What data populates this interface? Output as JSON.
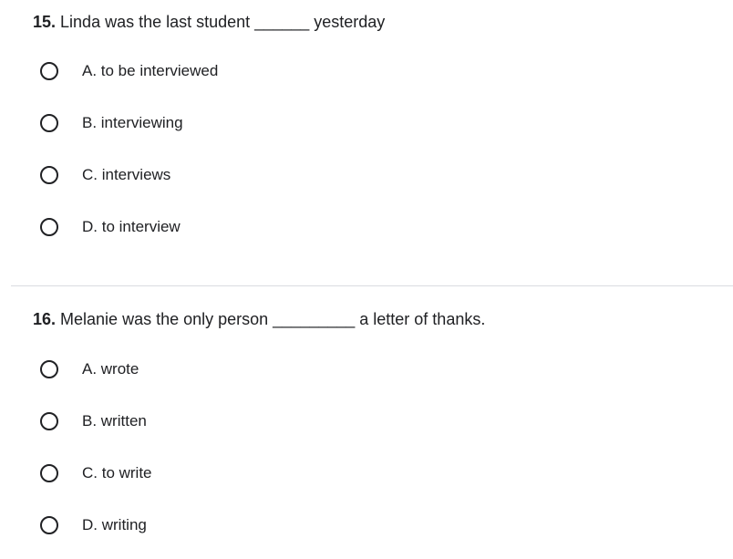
{
  "questions": [
    {
      "number": "15.",
      "text": " Linda was the last student ______ yesterday",
      "options": [
        {
          "label": "A. to be interviewed",
          "selected": false
        },
        {
          "label": "B. interviewing",
          "selected": false
        },
        {
          "label": "C. interviews",
          "selected": false
        },
        {
          "label": "D. to interview",
          "selected": false
        }
      ]
    },
    {
      "number": "16.",
      "text": " Melanie was the only person _________ a letter of thanks.",
      "options": [
        {
          "label": "A. wrote",
          "selected": false
        },
        {
          "label": "B. written",
          "selected": false
        },
        {
          "label": "C. to write",
          "selected": false
        },
        {
          "label": "D. writing",
          "selected": false
        }
      ]
    }
  ]
}
